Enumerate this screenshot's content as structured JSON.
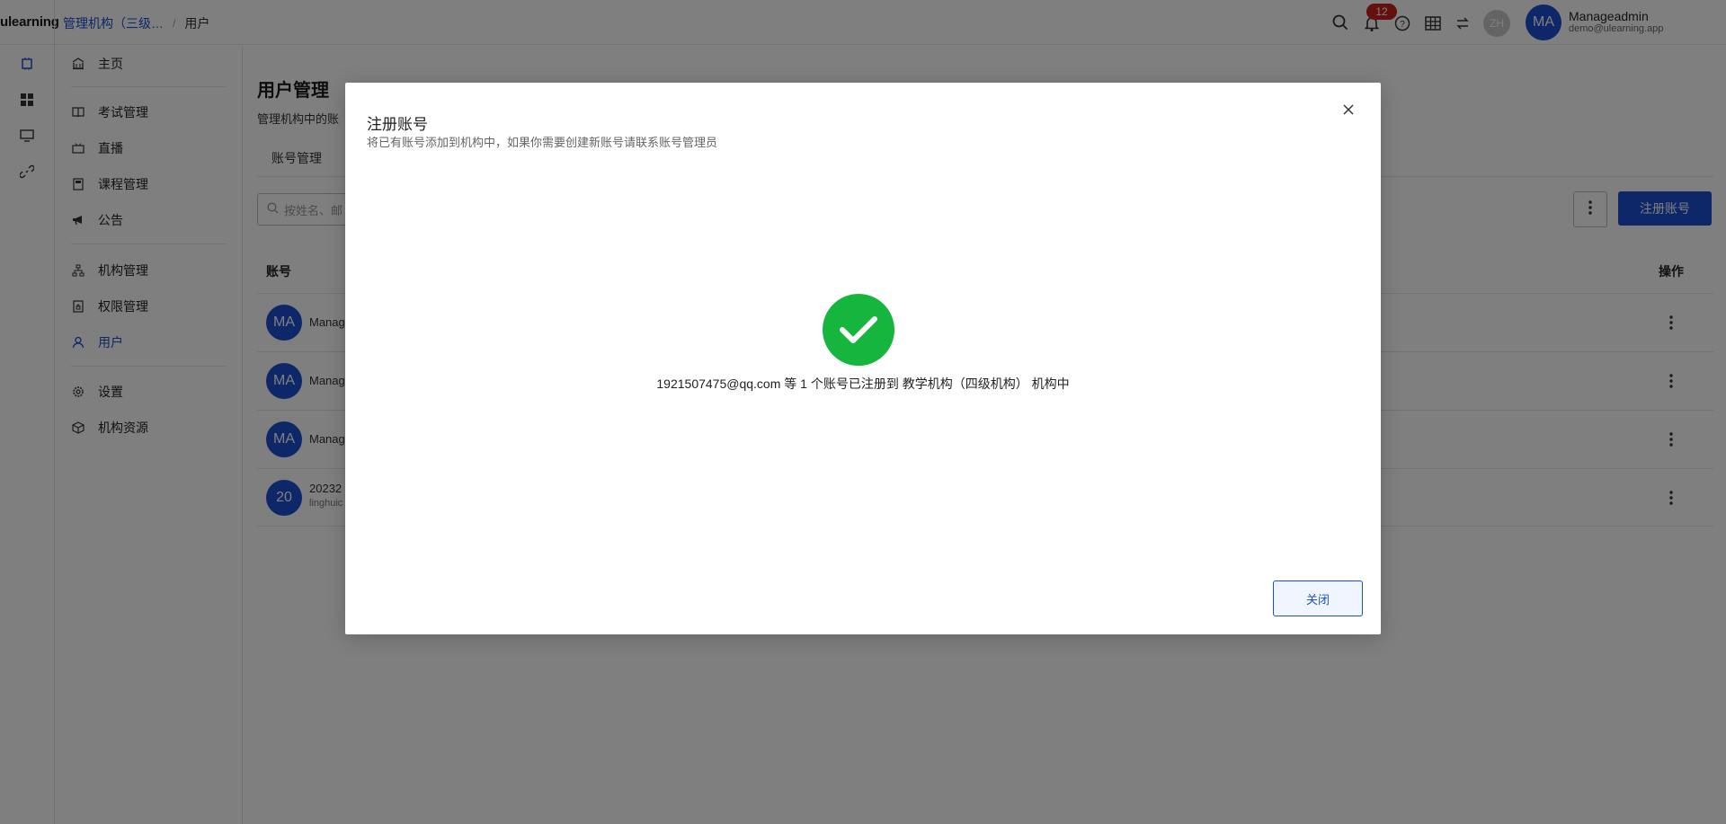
{
  "app": {
    "logo": "ulearning"
  },
  "breadcrumb": {
    "link": "管理机构（三级…",
    "separator": "/",
    "current": "用户"
  },
  "header": {
    "notification_count": "12",
    "language_badge": "ZH",
    "user": {
      "initials": "MA",
      "name": "Manageadmin",
      "email": "demo@ulearning.app"
    },
    "icons": [
      "search-icon",
      "bell-icon",
      "help-icon",
      "grid-icon",
      "switch-icon"
    ]
  },
  "rail": {
    "icons": [
      "chip-icon",
      "dashboard-icon",
      "monitor-icon",
      "link-icon"
    ]
  },
  "sidebar": {
    "items": [
      {
        "label": "主页",
        "icon": "home-icon"
      },
      {
        "label": "考试管理",
        "icon": "book-icon"
      },
      {
        "label": "直播",
        "icon": "live-icon"
      },
      {
        "label": "课程管理",
        "icon": "course-icon"
      },
      {
        "label": "公告",
        "icon": "megaphone-icon"
      },
      {
        "label": "机构管理",
        "icon": "org-icon"
      },
      {
        "label": "权限管理",
        "icon": "permission-icon"
      },
      {
        "label": "用户",
        "icon": "user-icon",
        "active": true
      },
      {
        "label": "设置",
        "icon": "gear-icon"
      },
      {
        "label": "机构资源",
        "icon": "cube-icon"
      }
    ]
  },
  "main": {
    "title": "用户管理",
    "description": "管理机构中的账",
    "tab": "账号管理",
    "search_placeholder": "按姓名、邮",
    "register_button": "注册账号",
    "table": {
      "headers": {
        "account": "账号",
        "actions": "操作"
      },
      "rows": [
        {
          "initials": "MA",
          "name": "Manag",
          "sub": ""
        },
        {
          "initials": "MA",
          "name": "Manag",
          "sub": ""
        },
        {
          "initials": "MA",
          "name": "Manag",
          "sub": ""
        },
        {
          "initials": "20",
          "name": "20232",
          "sub": "linghuic"
        }
      ]
    }
  },
  "modal": {
    "title": "注册账号",
    "subtitle": "将已有账号添加到机构中，如果你需要创建新账号请联系账号管理员",
    "message": "1921507475@qq.com 等 1 个账号已注册到 教学机构（四级机构） 机构中",
    "close_button": "关闭",
    "success_color": "#16b53d"
  },
  "colors": {
    "accent": "#1a4fd0",
    "badge": "#c9201f"
  }
}
